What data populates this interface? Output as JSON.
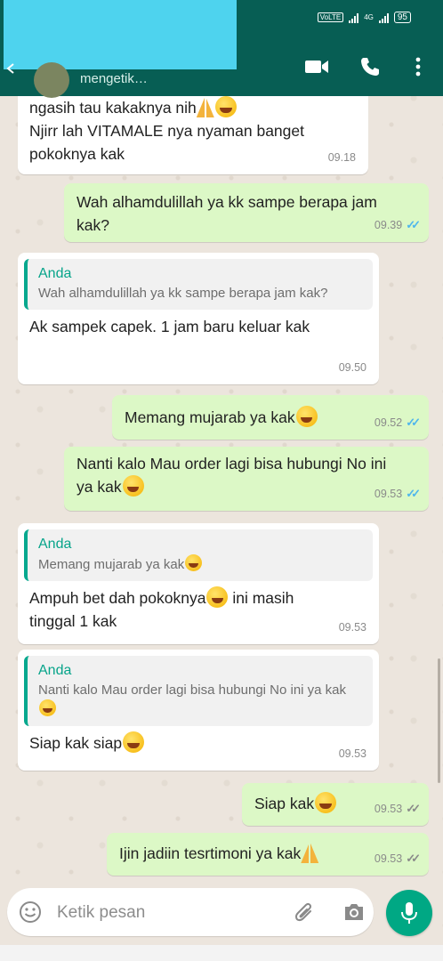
{
  "header": {
    "status_text": "mengetik…",
    "battery": "95",
    "network": "4G",
    "icons": [
      "back-arrow-icon",
      "video-call-icon",
      "phone-call-icon",
      "more-options-icon"
    ]
  },
  "messages": [
    {
      "side": "in",
      "lines": [
        "ngasih tau kakaknya nih",
        "Njirr lah VITAMALE nya nyaman banget",
        "pokoknya kak"
      ],
      "time": "09.18"
    },
    {
      "side": "out",
      "text": "Wah alhamdulillah ya kk sampe berapa jam kak?",
      "time": "09.39",
      "read": true
    },
    {
      "side": "in",
      "quote_author": "Anda",
      "quote_text": "Wah alhamdulillah ya kk sampe berapa jam kak?",
      "text": "Ak sampek capek.  1 jam baru keluar kak",
      "time": "09.50"
    },
    {
      "side": "out",
      "text": "Memang mujarab ya kak",
      "time": "09.52",
      "read": true
    },
    {
      "side": "out",
      "text": "Nanti kalo Mau order lagi bisa hubungi No ini ya kak",
      "time": "09.53",
      "read": true
    },
    {
      "side": "in",
      "quote_author": "Anda",
      "quote_text": "Memang mujarab ya kak",
      "text_a": "Ampuh bet dah pokoknya",
      "text_b": " ini masih tinggal 1 kak",
      "time": "09.53"
    },
    {
      "side": "in",
      "quote_author": "Anda",
      "quote_text": "Nanti kalo Mau order lagi bisa hubungi No ini ya kak",
      "text": "Siap kak siap",
      "time": "09.53"
    },
    {
      "side": "out",
      "text": "Siap kak",
      "time": "09.53",
      "read": false
    },
    {
      "side": "out",
      "text": "Ijin jadiin tesrtimoni ya kak",
      "time": "09.53",
      "read": false
    }
  ],
  "composer": {
    "placeholder": "Ketik pesan"
  },
  "colors": {
    "header": "#075e54",
    "outgoing_bubble": "#dcf8c6",
    "incoming_bubble": "#ffffff",
    "quote_accent": "#06a88e",
    "read_ticks": "#4fb6ec",
    "mic_button": "#00a884"
  }
}
